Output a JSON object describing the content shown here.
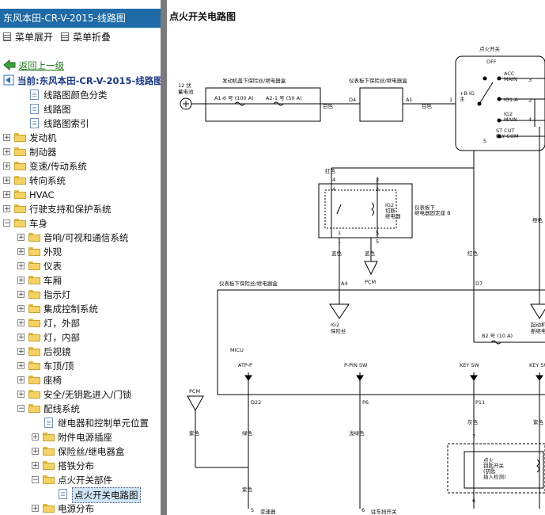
{
  "sidebar": {
    "title": "东风本田-CR-V-2015-线路图",
    "expand_all": "菜单展开",
    "collapse_all": "菜单折叠",
    "back": "返回上一级",
    "current": "当前:东风本田-CR-V-2015-线路图",
    "tree": [
      {
        "label": "线路图颜色分类",
        "type": "doc",
        "level": 1,
        "toggle": ""
      },
      {
        "label": "线路图",
        "type": "doc",
        "level": 1,
        "toggle": ""
      },
      {
        "label": "线路图索引",
        "type": "doc",
        "level": 1,
        "toggle": ""
      },
      {
        "label": "发动机",
        "type": "folder",
        "level": 0,
        "toggle": "+"
      },
      {
        "label": "制动器",
        "type": "folder",
        "level": 0,
        "toggle": "+"
      },
      {
        "label": "变速/传动系统",
        "type": "folder",
        "level": 0,
        "toggle": "+"
      },
      {
        "label": "转向系统",
        "type": "folder",
        "level": 0,
        "toggle": "+"
      },
      {
        "label": "HVAC",
        "type": "folder",
        "level": 0,
        "toggle": "+"
      },
      {
        "label": "行驶支持和保护系统",
        "type": "folder",
        "level": 0,
        "toggle": "+"
      },
      {
        "label": "车身",
        "type": "folder",
        "level": 0,
        "toggle": "-"
      },
      {
        "label": "音响/可视和通信系统",
        "type": "folder",
        "level": 1,
        "toggle": "+"
      },
      {
        "label": "外观",
        "type": "folder",
        "level": 1,
        "toggle": "+"
      },
      {
        "label": "仪表",
        "type": "folder",
        "level": 1,
        "toggle": "+"
      },
      {
        "label": "车厢",
        "type": "folder",
        "level": 1,
        "toggle": "+"
      },
      {
        "label": "指示灯",
        "type": "folder",
        "level": 1,
        "toggle": "+"
      },
      {
        "label": "集成控制系统",
        "type": "folder",
        "level": 1,
        "toggle": "+"
      },
      {
        "label": "灯，外部",
        "type": "folder",
        "level": 1,
        "toggle": "+"
      },
      {
        "label": "灯，内部",
        "type": "folder",
        "level": 1,
        "toggle": "+"
      },
      {
        "label": "后视镜",
        "type": "folder",
        "level": 1,
        "toggle": "+"
      },
      {
        "label": "车顶/顶",
        "type": "folder",
        "level": 1,
        "toggle": "+"
      },
      {
        "label": "座椅",
        "type": "folder",
        "level": 1,
        "toggle": "+"
      },
      {
        "label": "安全/无钥匙进入/门锁",
        "type": "folder",
        "level": 1,
        "toggle": "+"
      },
      {
        "label": "配线系统",
        "type": "folder",
        "level": 1,
        "toggle": "-"
      },
      {
        "label": "继电器和控制单元位置",
        "type": "doc",
        "level": 2,
        "toggle": ""
      },
      {
        "label": "附件电源插座",
        "type": "folder",
        "level": 2,
        "toggle": "+"
      },
      {
        "label": "保险丝/继电器盒",
        "type": "folder",
        "level": 2,
        "toggle": "+"
      },
      {
        "label": "搭铁分布",
        "type": "folder",
        "level": 2,
        "toggle": "+"
      },
      {
        "label": "点火开关部件",
        "type": "folder",
        "level": 2,
        "toggle": "-"
      },
      {
        "label": "点火开关电路图",
        "type": "doc",
        "level": 3,
        "toggle": "",
        "selected": true
      },
      {
        "label": "电源分布",
        "type": "folder",
        "level": 2,
        "toggle": "+"
      }
    ]
  },
  "content": {
    "title": "点火开关电路图"
  },
  "diagram": {
    "battery_label_1": "12 伏",
    "battery_label_2": "蓄电池",
    "under_hood_box": "发动机盖下保险丝/继电器盒",
    "fuse_a16": "A1-6 号 (100 A)",
    "fuse_a21": "A2-1 号 (50 A)",
    "under_dash_box_top": "仪表板下保险丝/继电器盒",
    "d4": "D4",
    "a1": "A1",
    "white_1": "白色",
    "white_2": "白色",
    "white_3": "白色",
    "pin_1": "1",
    "ignition_switch": "点火开关",
    "off": "OFF",
    "acc_main_1": "ACC",
    "acc_main_2": "MAIN",
    "ig1a": "IG1-A",
    "ig2_main_1": "IG2",
    "ig2_main_2": "MAIN",
    "stcut_1": "ST CUT",
    "stcut_2": "RLY COM",
    "bigmain_1": "+B IG",
    "bigmain_2": "主",
    "sw_pin_3": "3",
    "sw_pin_3b": "3",
    "sw_pin_4": "4",
    "sw_pin_5": "5",
    "red_1": "红色",
    "relay_pin_4a": "4",
    "relay_pin_3a": "3",
    "relay_pin_4b": "4",
    "relay_pin_3b": "3",
    "relay_pin_1a": "1",
    "relay_pin_5a": "5",
    "relay_pin_1b": "1",
    "relay_pin_5b": "5",
    "ig2_relay_1": "IG2",
    "ig2_relay_2": "切断",
    "ig2_relay_3": "继电器",
    "under_dash_relay_1": "仪表板下",
    "under_dash_relay_2": "继电器固定座 B",
    "blue_1": "蓝色",
    "blue_2": "蓝色",
    "red_2": "红色",
    "orange_1": "橙色",
    "pcm_1": "PCM",
    "under_dash_box_mid": "仪表板下保险丝/继电器盒",
    "a4": "A4",
    "d7": "D7",
    "ig2_fuse_1": "IG2",
    "ig2_fuse_2": "保险丝",
    "fuse_b2": "B2 号 (10 A)",
    "jumpstart_1": "起动机切",
    "jumpstart_2": "断继电器",
    "micu": "MICU",
    "atp_p": "ATP-P",
    "p_pin_sw": "P-PIN SW",
    "key_sw_1": "KEY SW",
    "key_sw_2": "KEY SW",
    "pcm_2": "PCM",
    "d22": "D22",
    "p6": "P6",
    "p11": "P11",
    "purple_1": "紫色",
    "green_1": "绿色",
    "lightgreen_1": "浅绿色",
    "gray_1": "灰色",
    "purple_2": "紫色",
    "purple_3": "紫色",
    "lock_pin_7": "7",
    "lock_pin_6": "6",
    "lock_pin_5": "5",
    "lock_pin_6b": "6",
    "lock_label_1": "点火",
    "lock_label_2": "钥匙开关",
    "lock_label_3": "(钥匙",
    "lock_label_4": "插入检测)",
    "bottom_1": "变速器",
    "bottom_2": "驻车挡开关"
  }
}
